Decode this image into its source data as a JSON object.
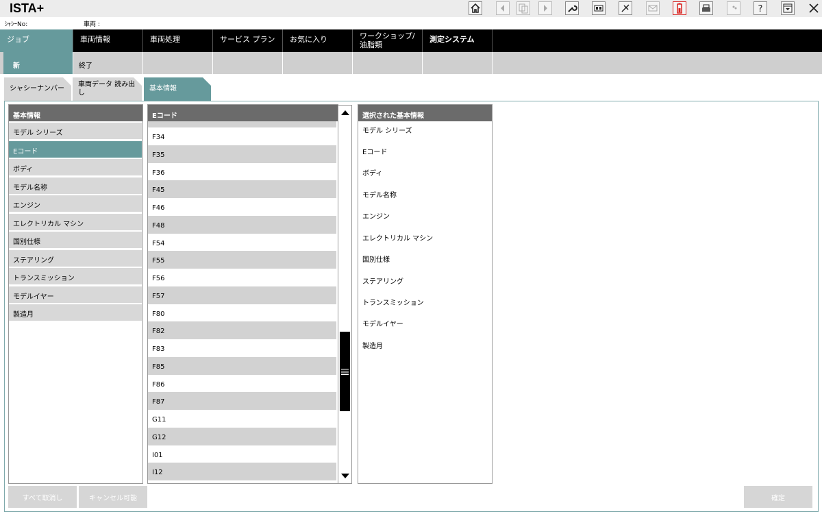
{
  "app": {
    "title": "ISTA+"
  },
  "info": {
    "chassis_label": "ｼｬｼｰNo:",
    "vehicle_label": "車両 :"
  },
  "mainnav": [
    "ジョブ",
    "車両情報",
    "車両処理",
    "サービス プラン",
    "お気に入り",
    "ワークショップ/ 油脂類",
    "測定システム"
  ],
  "subnav": [
    "新",
    "終了"
  ],
  "pagetabs": [
    "シャシーナンバー",
    "車両データ 読み出し",
    "基本情報"
  ],
  "left": {
    "header": "基本情報",
    "items": [
      "モデル シリーズ",
      "Eコード",
      "ボディ",
      "モデル名称",
      "エンジン",
      "エレクトリカル マシン",
      "国別仕様",
      "ステアリング",
      "トランスミッション",
      "モデルイヤー",
      "製造月"
    ]
  },
  "middle": {
    "header": "Eコード",
    "rows": [
      "F34",
      "F35",
      "F36",
      "F45",
      "F46",
      "F48",
      "F54",
      "F55",
      "F56",
      "F57",
      "F80",
      "F82",
      "F83",
      "F85",
      "F86",
      "F87",
      "G11",
      "G12",
      "I01",
      "I12"
    ]
  },
  "right": {
    "header": "選択された基本情報",
    "items": [
      "モデル シリーズ",
      "Eコード",
      "ボディ",
      "モデル名称",
      "エンジン",
      "エレクトリカル マシン",
      "国別仕様",
      "ステアリング",
      "トランスミッション",
      "モデルイヤー",
      "製造月"
    ]
  },
  "buttons": {
    "clear_all": "すべて取消し",
    "cancel_enabled": "キャンセル可能",
    "confirm": "確定"
  },
  "colors": {
    "accent": "#669a9c",
    "header": "#6b6b6b",
    "nav": "#000000",
    "alert": "#d9221f"
  }
}
